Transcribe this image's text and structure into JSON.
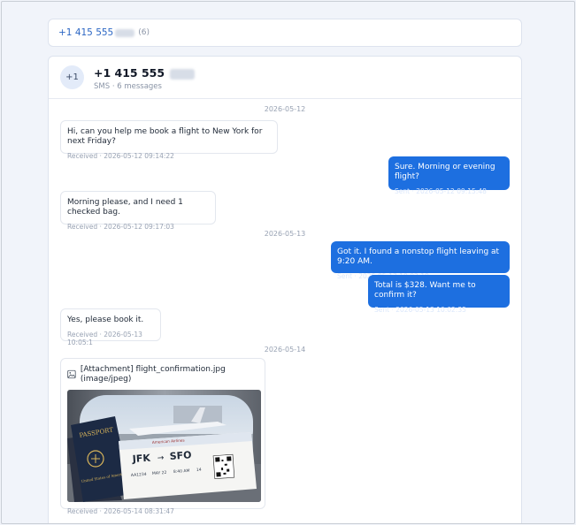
{
  "header": {
    "number_prefix": "+1 415 555",
    "count": "(6)"
  },
  "contact": {
    "avatar": "+1",
    "name_prefix": "+1 415 555",
    "subtitle": "SMS · 6 messages"
  },
  "dates": [
    "2026-05-12",
    "2026-05-13",
    "2026-05-14"
  ],
  "messages": [
    {
      "direction": "in",
      "text": "Hi, can you help me book a flight to New York for next Friday?",
      "meta": "Received · 2026-05-12 09:14:22"
    },
    {
      "direction": "out",
      "text": "Sure. Morning or evening flight?",
      "meta": "Sent · 2026-05-12 09:15:48"
    },
    {
      "direction": "in",
      "text": "Morning please, and I need 1 checked bag.",
      "meta": "Received · 2026-05-12 09:17:03"
    },
    {
      "direction": "out",
      "text": "Got it. I found a nonstop flight leaving at 9:20 AM.",
      "meta": "Sent · 2026-05-13 10:02:19"
    },
    {
      "direction": "out",
      "text": "Total is $328. Want me to confirm it?",
      "meta": "Sent · 2026-05-13 10:02:35"
    },
    {
      "direction": "in",
      "text": "Yes, please book it.",
      "meta": "Received · 2026-05-13 10:05:1"
    },
    {
      "direction": "in",
      "attachment": "[Attachment] flight_confirmation.jpg (image/jpeg)",
      "meta": "Received · 2026-05-14 08:31:47"
    }
  ],
  "photo": {
    "passport": "PASSPORT",
    "passport_country": "United States of America",
    "airline": "American Airlines",
    "from": "JFK",
    "arrow": "→",
    "to": "SFO",
    "flight": "AA1234",
    "date": "MAY 22",
    "time": "8:40 AM",
    "seat": "14"
  },
  "colors": {
    "accent": "#1d6fe0",
    "background": "#f1f4fa"
  }
}
